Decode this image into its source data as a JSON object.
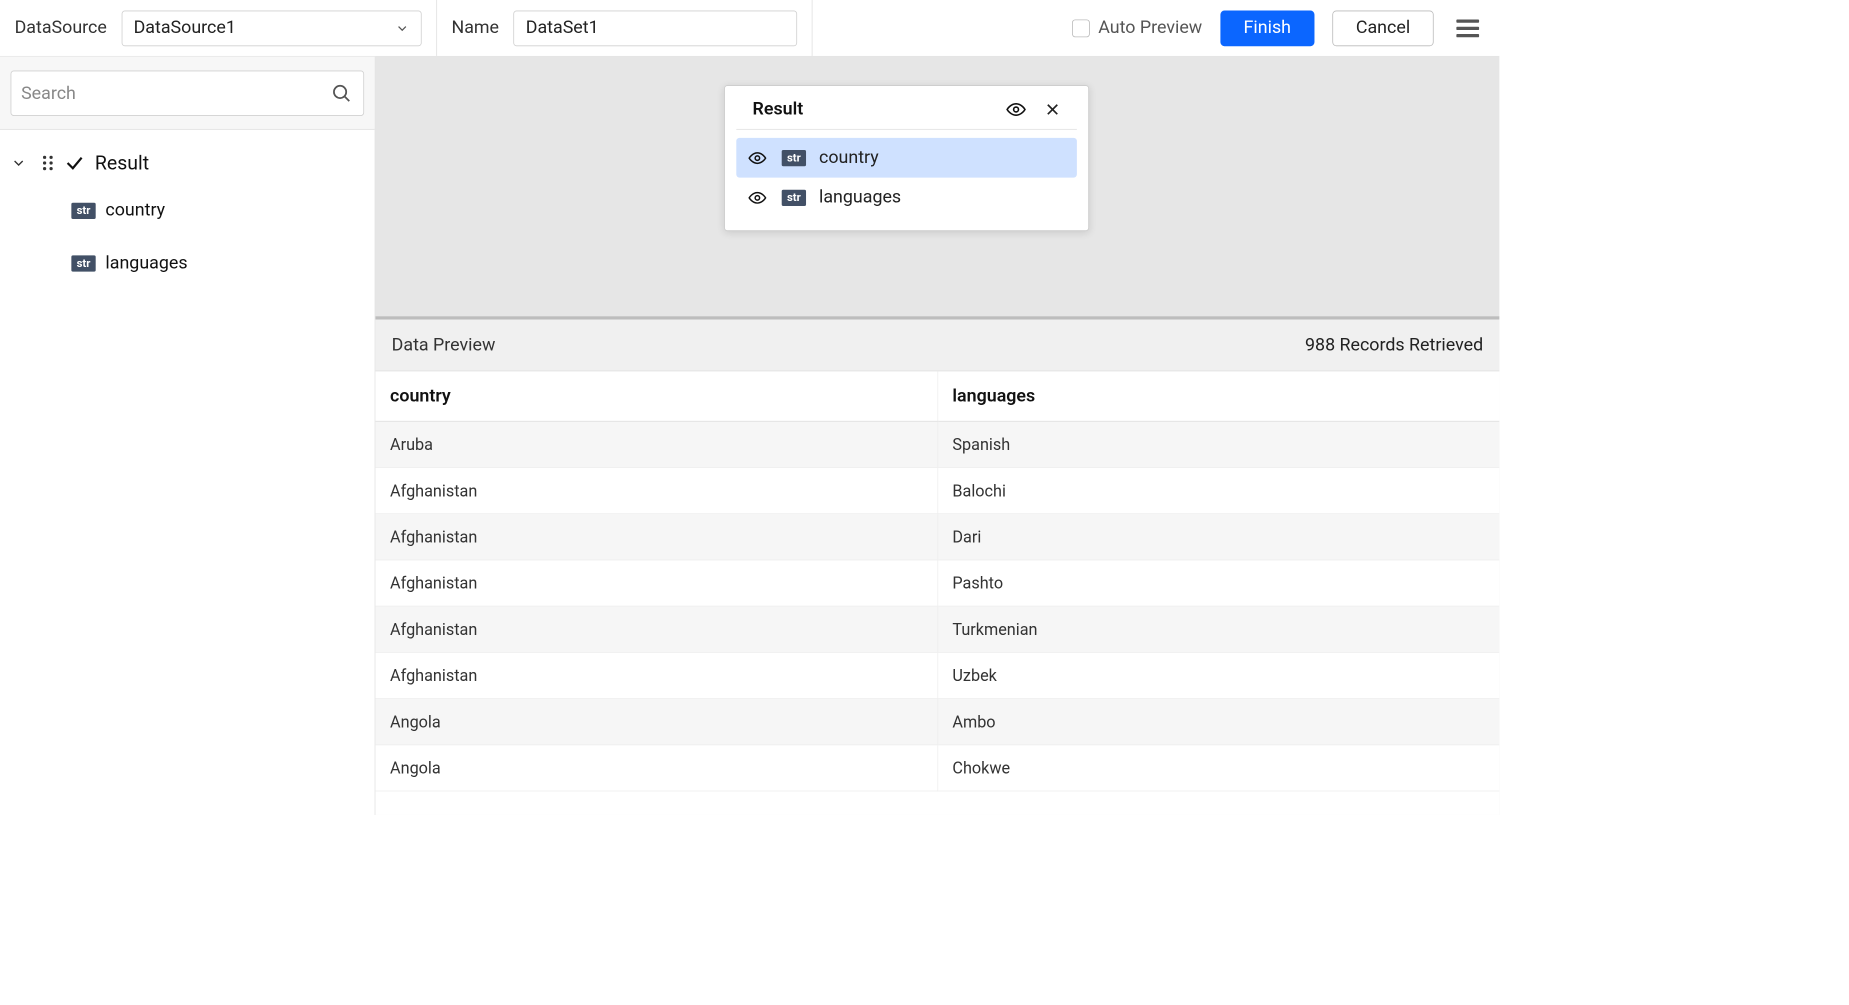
{
  "topbar": {
    "datasource_label": "DataSource",
    "datasource_value": "DataSource1",
    "name_label": "Name",
    "name_value": "DataSet1",
    "auto_preview_label": "Auto Preview",
    "finish_label": "Finish",
    "cancel_label": "Cancel"
  },
  "sidebar": {
    "search_placeholder": "Search",
    "root_label": "Result",
    "fields": [
      {
        "type": "str",
        "name": "country"
      },
      {
        "type": "str",
        "name": "languages"
      }
    ]
  },
  "result_card": {
    "title": "Result",
    "fields": [
      {
        "type": "str",
        "name": "country",
        "selected": true
      },
      {
        "type": "str",
        "name": "languages",
        "selected": false
      }
    ]
  },
  "preview": {
    "title": "Data Preview",
    "records_text": "988 Records Retrieved",
    "columns": [
      "country",
      "languages"
    ],
    "rows": [
      [
        "Aruba",
        "Spanish"
      ],
      [
        "Afghanistan",
        "Balochi"
      ],
      [
        "Afghanistan",
        "Dari"
      ],
      [
        "Afghanistan",
        "Pashto"
      ],
      [
        "Afghanistan",
        "Turkmenian"
      ],
      [
        "Afghanistan",
        "Uzbek"
      ],
      [
        "Angola",
        "Ambo"
      ],
      [
        "Angola",
        "Chokwe"
      ]
    ]
  }
}
